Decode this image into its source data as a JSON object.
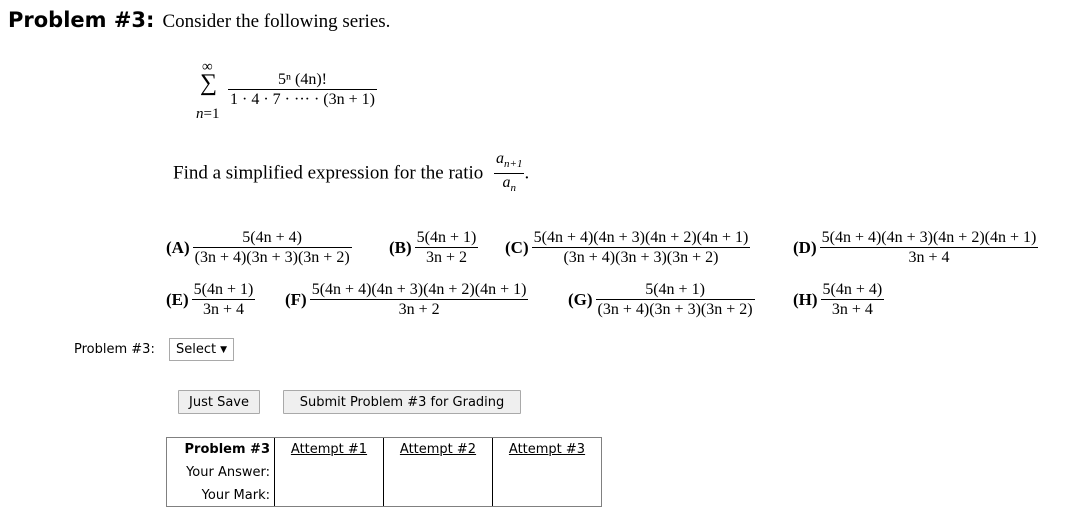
{
  "header": {
    "title": "Problem #3:",
    "intro": "Consider the following series."
  },
  "series": {
    "sum_symbol": "∑",
    "upper_limit": "∞",
    "lower_var": "n",
    "lower_eq": "=1",
    "numerator": "5ⁿ (4n)!",
    "denominator": "1 · 4 · 7 · ··· · (3n + 1)"
  },
  "question": {
    "text": "Find a simplified expression for the ratio",
    "ratio_num": "a",
    "ratio_num_sub": "n+1",
    "ratio_den": "a",
    "ratio_den_sub": "n",
    "end": "."
  },
  "options": [
    {
      "letter": "(A)",
      "numerator": "5(4n + 4)",
      "denominator": "(3n + 4)(3n + 3)(3n + 2)"
    },
    {
      "letter": "(B)",
      "numerator": "5(4n + 1)",
      "denominator": "3n + 2"
    },
    {
      "letter": "(C)",
      "numerator": "5(4n + 4)(4n + 3)(4n + 2)(4n + 1)",
      "denominator": "(3n + 4)(3n + 3)(3n + 2)"
    },
    {
      "letter": "(D)",
      "numerator": "5(4n + 4)(4n + 3)(4n + 2)(4n + 1)",
      "denominator": "3n + 4"
    },
    {
      "letter": "(E)",
      "numerator": "5(4n + 1)",
      "denominator": "3n + 4"
    },
    {
      "letter": "(F)",
      "numerator": "5(4n + 4)(4n + 3)(4n + 2)(4n + 1)",
      "denominator": "3n + 2"
    },
    {
      "letter": "(G)",
      "numerator": "5(4n + 1)",
      "denominator": "(3n + 4)(3n + 3)(3n + 2)"
    },
    {
      "letter": "(H)",
      "numerator": "5(4n + 4)",
      "denominator": "3n + 4"
    }
  ],
  "answer": {
    "label": "Problem #3:",
    "select_value": "Select",
    "select_arrow": "▼"
  },
  "buttons": {
    "save": "Just Save",
    "submit": "Submit Problem #3 for Grading"
  },
  "attempts_table": {
    "row_header": "Problem #3",
    "row_answer": "Your Answer:",
    "row_mark": "Your Mark:",
    "attempts": [
      "Attempt #1",
      "Attempt #2",
      "Attempt #3"
    ]
  }
}
